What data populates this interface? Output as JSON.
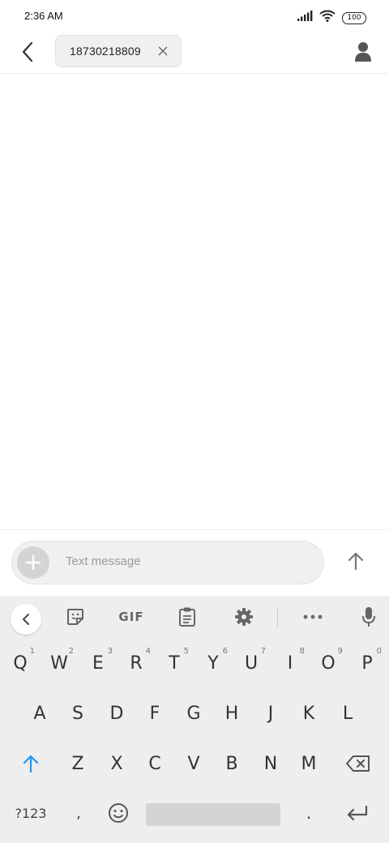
{
  "status_bar": {
    "time": "2:36 AM",
    "battery": "100"
  },
  "header": {
    "recipient": "18730218809"
  },
  "compose": {
    "placeholder": "Text message"
  },
  "keyboard": {
    "toolbar": {
      "gif_label": "GIF"
    },
    "row1": [
      {
        "label": "Q",
        "hint": "1"
      },
      {
        "label": "W",
        "hint": "2"
      },
      {
        "label": "E",
        "hint": "3"
      },
      {
        "label": "R",
        "hint": "4"
      },
      {
        "label": "T",
        "hint": "5"
      },
      {
        "label": "Y",
        "hint": "6"
      },
      {
        "label": "U",
        "hint": "7"
      },
      {
        "label": "I",
        "hint": "8"
      },
      {
        "label": "O",
        "hint": "9"
      },
      {
        "label": "P",
        "hint": "0"
      }
    ],
    "row2": [
      "A",
      "S",
      "D",
      "F",
      "G",
      "H",
      "J",
      "K",
      "L"
    ],
    "row3": [
      "Z",
      "X",
      "C",
      "V",
      "B",
      "N",
      "M"
    ],
    "symbols_label": "?123",
    "comma_label": ",",
    "period_label": ".",
    "accent_color": "#2196f3"
  }
}
